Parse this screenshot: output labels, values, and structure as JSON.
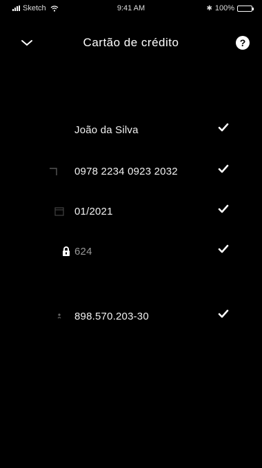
{
  "status_bar": {
    "carrier": "Sketch",
    "time": "9:41 AM",
    "battery": "100%"
  },
  "nav": {
    "title": "Cartão de crédito",
    "help_label": "?"
  },
  "fields": [
    {
      "name": "holder-name",
      "icon": "none",
      "value": "João da Silva",
      "checked": true
    },
    {
      "name": "card-number",
      "icon": "card-icon",
      "value": "0978 2234 0923 2032",
      "checked": true
    },
    {
      "name": "expiry-date",
      "icon": "calendar-icon",
      "value": "01/2021",
      "checked": true
    },
    {
      "name": "cvv",
      "icon": "lock-icon",
      "value": "624",
      "checked": true
    },
    {
      "name": "cpf",
      "icon": "person-icon",
      "value": "898.570.203-30",
      "checked": true
    }
  ]
}
